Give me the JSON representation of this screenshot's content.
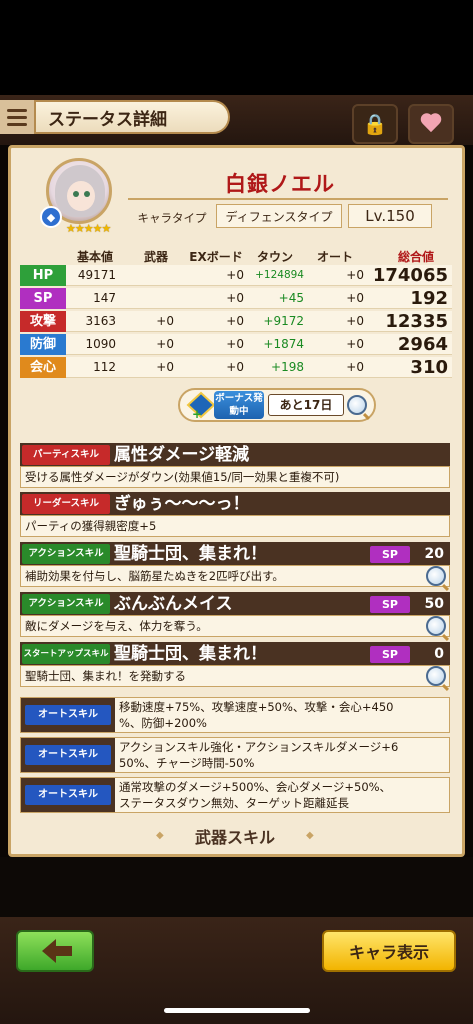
{
  "header": {
    "title": "ステータス詳細"
  },
  "character": {
    "name": "白銀ノエル",
    "type_label": "キャラタイプ",
    "type_value": "ディフェンスタイプ",
    "level": "Lv.150",
    "stars": "★★★★★"
  },
  "stats": {
    "headers": [
      "基本値",
      "武器",
      "EXボード",
      "タウン",
      "オート",
      "総合値"
    ],
    "rows": [
      {
        "label": "HP",
        "color": "#2ea03a",
        "base": "49171",
        "weapon": "",
        "exboard": "+0",
        "town": "+124894",
        "auto": "+0",
        "total": "174065"
      },
      {
        "label": "SP",
        "color": "#b02fc0",
        "base": "147",
        "weapon": "",
        "exboard": "+0",
        "town": "+45",
        "auto": "+0",
        "total": "192"
      },
      {
        "label": "攻撃",
        "color": "#c62a2a",
        "base": "3163",
        "weapon": "+0",
        "exboard": "+0",
        "town": "+9172",
        "auto": "+0",
        "total": "12335"
      },
      {
        "label": "防御",
        "color": "#2a7ad0",
        "base": "1090",
        "weapon": "+0",
        "exboard": "+0",
        "town": "+1874",
        "auto": "+0",
        "total": "2964"
      },
      {
        "label": "会心",
        "color": "#e08a1c",
        "base": "112",
        "weapon": "+0",
        "exboard": "+0",
        "town": "+198",
        "auto": "+0",
        "total": "310"
      }
    ]
  },
  "bonus": {
    "tag": "ボーナス発動中",
    "days": "あと17日"
  },
  "skills": [
    {
      "tag": "パーティスキル",
      "name": "属性ダメージ軽減",
      "desc": "受ける属性ダメージがダウン(効果値15/同一効果と重複不可)",
      "sp_label": "",
      "sp": ""
    },
    {
      "tag": "リーダースキル",
      "name": "ぎゅぅ～～～っ！",
      "desc": "パーティの獲得親密度+5",
      "sp_label": "",
      "sp": ""
    },
    {
      "tag": "アクションスキル",
      "name": "聖騎士団、集まれ！",
      "desc": "補助効果を付与し、脳筋星たぬきを2匹呼び出す。",
      "sp_label": "SP",
      "sp": "20"
    },
    {
      "tag": "アクションスキル",
      "name": "ぶんぶんメイス",
      "desc": "敵にダメージを与え、体力を奪う。",
      "sp_label": "SP",
      "sp": "50"
    },
    {
      "tag": "スタートアップスキル",
      "name": "聖騎士団、集まれ！",
      "desc": "聖騎士団、集まれ！を発動する",
      "sp_label": "SP",
      "sp": "0"
    }
  ],
  "auto_skills": [
    {
      "tag": "オートスキル",
      "line1": "移動速度+75%、攻撃速度+50%、攻撃・会心+450",
      "line2": "%、防御+200%"
    },
    {
      "tag": "オートスキル",
      "line1": "アクションスキル強化・アクションスキルダメージ+6",
      "line2": "50%、チャージ時間-50%"
    },
    {
      "tag": "オートスキル",
      "line1": "通常攻撃のダメージ+500%、会心ダメージ+50%、",
      "line2": "ステータスダウン無効、ターゲット距離延長"
    }
  ],
  "weapon_skill_title": "武器スキル",
  "footer": {
    "chara_button": "キャラ表示"
  }
}
